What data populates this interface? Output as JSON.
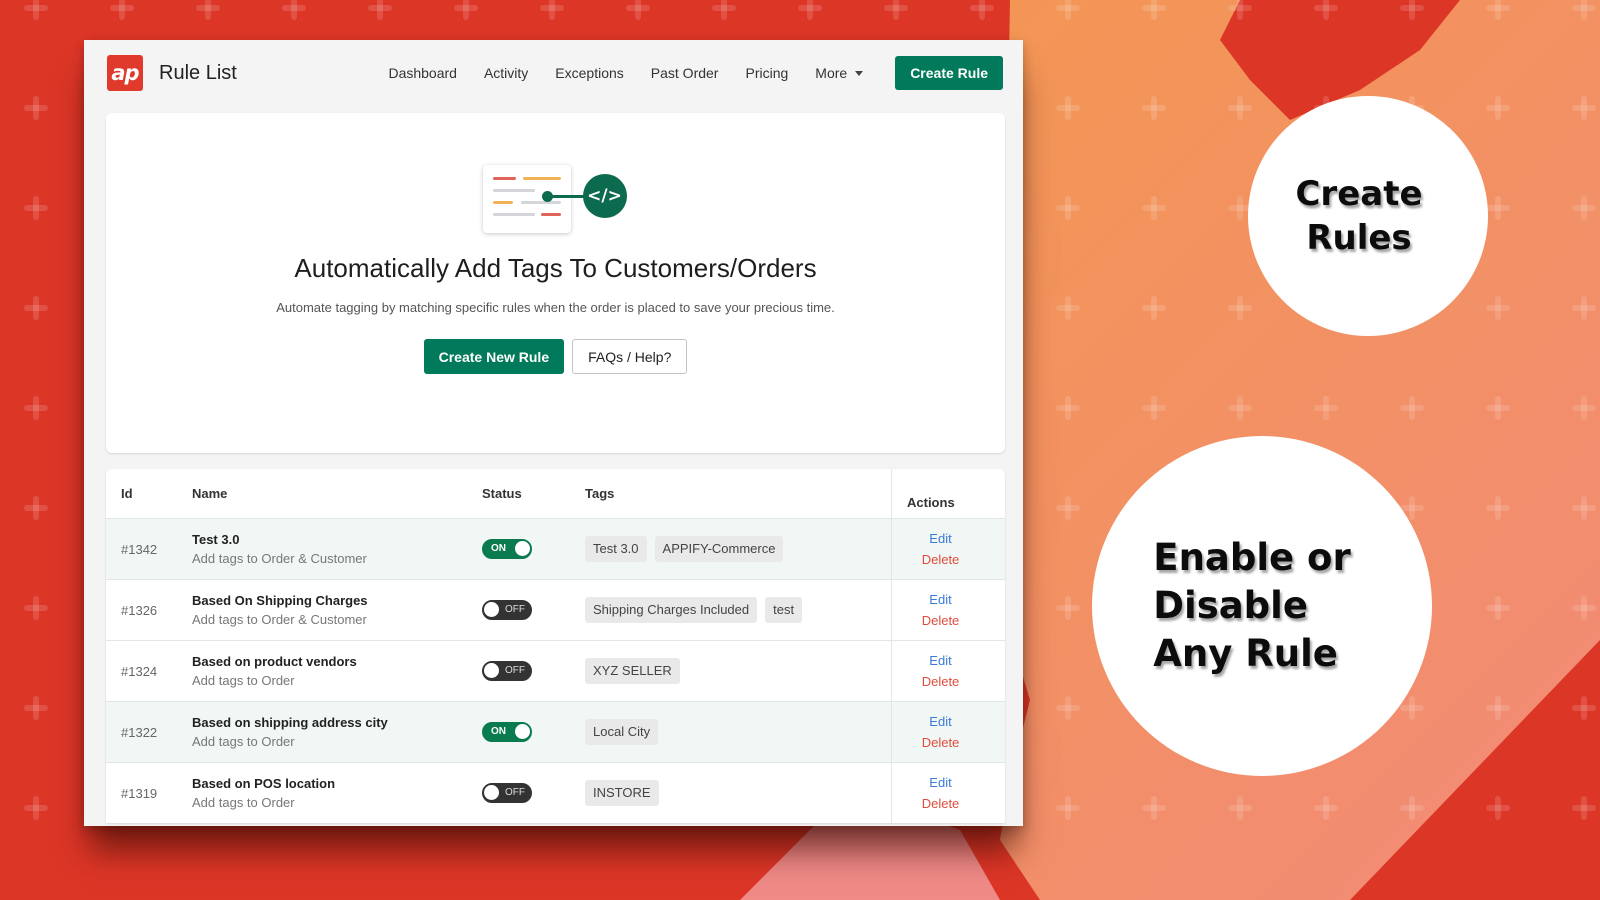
{
  "promo": {
    "badge_one_lines": [
      "Create",
      "Rules"
    ],
    "badge_two_lines": [
      "Enable or",
      "Disable",
      "Any Rule"
    ],
    "colors": {
      "background_red": "#dc3627",
      "orange": "#f39557",
      "accent_green": "#007a5a"
    }
  },
  "app": {
    "logo_text": "ap",
    "title": "Rule List",
    "nav": [
      {
        "label": "Dashboard"
      },
      {
        "label": "Activity"
      },
      {
        "label": "Exceptions"
      },
      {
        "label": "Past Order"
      },
      {
        "label": "Pricing"
      },
      {
        "label": "More"
      }
    ],
    "create_rule_label": "Create Rule"
  },
  "hero": {
    "icon_symbol": "</>",
    "title": "Automatically Add Tags To Customers/Orders",
    "subtitle": "Automate tagging by matching specific rules when the order is placed to save your precious time.",
    "primary_label": "Create New Rule",
    "secondary_label": "FAQs / Help?"
  },
  "table": {
    "headers": {
      "id": "Id",
      "name": "Name",
      "status": "Status",
      "tags": "Tags",
      "actions": "Actions"
    },
    "edit_label": "Edit",
    "delete_label": "Delete",
    "rows": [
      {
        "id": "#1342",
        "name": "Test 3.0",
        "sub": "Add tags to Order & Customer",
        "status": "ON",
        "enabled": true,
        "tags": [
          "Test 3.0",
          "APPIFY-Commerce"
        ]
      },
      {
        "id": "#1326",
        "name": "Based On Shipping Charges",
        "sub": "Add tags to Order & Customer",
        "status": "OFF",
        "enabled": false,
        "tags": [
          "Shipping Charges Included",
          "test"
        ]
      },
      {
        "id": "#1324",
        "name": "Based on product vendors",
        "sub": "Add tags to Order",
        "status": "OFF",
        "enabled": false,
        "tags": [
          "XYZ SELLER"
        ]
      },
      {
        "id": "#1322",
        "name": "Based on shipping address city",
        "sub": "Add tags to Order",
        "status": "ON",
        "enabled": true,
        "tags": [
          "Local City"
        ]
      },
      {
        "id": "#1319",
        "name": "Based on POS location",
        "sub": "Add tags to Order",
        "status": "OFF",
        "enabled": false,
        "tags": [
          "INSTORE"
        ]
      }
    ]
  }
}
